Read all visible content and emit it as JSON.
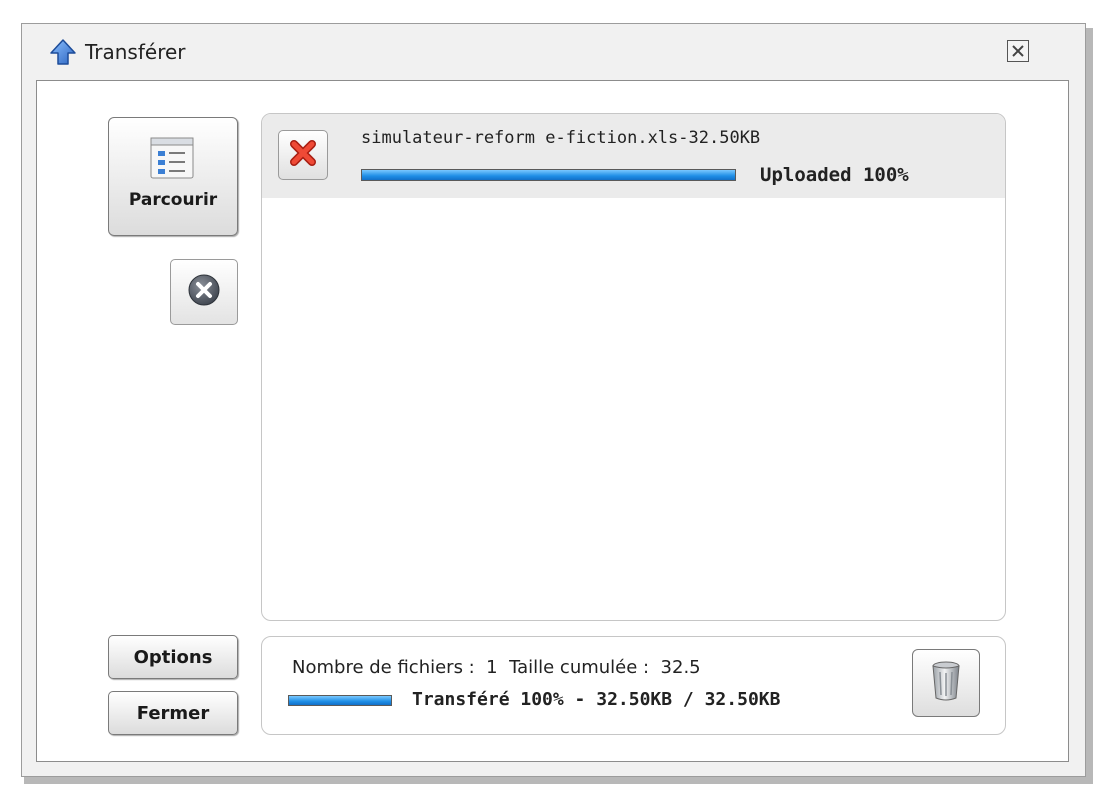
{
  "window": {
    "title": "Transférer",
    "title_icon": "up-arrow-icon",
    "close_icon": "close-window-icon"
  },
  "toolbar": {
    "browse_label": "Parcourir",
    "browse_icon": "file-list-icon",
    "cancel_all_icon": "cancel-circle-icon",
    "options_label": "Options",
    "close_label": "Fermer"
  },
  "files": [
    {
      "name": "simulateur-reform e-fiction.xls-32.50KB",
      "status": "Uploaded 100%",
      "progress_percent": 100,
      "remove_icon": "red-x-icon"
    }
  ],
  "summary": {
    "counts_text": "Nombre de fichiers :  1  Taille cumulée :  32.5",
    "status": "Transféré 100% - 32.50KB / 32.50KB",
    "progress_percent": 100,
    "clear_icon": "trash-can-icon"
  },
  "colors": {
    "progress_blue": "#1e8ee6",
    "remove_red": "#e23a2a",
    "title_icon_blue": "#3d7fd6"
  }
}
